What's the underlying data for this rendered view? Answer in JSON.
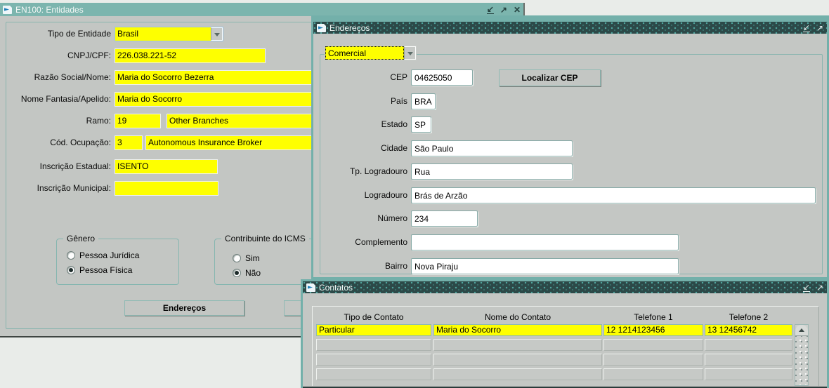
{
  "icons": {
    "minimize": "↙",
    "maximize": "↗",
    "close": "✕"
  },
  "colors": {
    "titlebar_teal": "#7cb5ae",
    "titlebar_dark": "#2c4948",
    "field_yellow": "#feff00",
    "frame_teal": "#73b0aa",
    "window_gray": "#c3c6c3",
    "desktop": "#e9ece9"
  },
  "window_entidades": {
    "title": "EN100: Entidades",
    "fields": {
      "tipo": {
        "label": "Tipo de Entidade",
        "value": "Brasil"
      },
      "cnpj": {
        "label": "CNPJ/CPF:",
        "value": "226.038.221-52"
      },
      "razao": {
        "label": "Razão Social/Nome:",
        "value": "Maria do Socorro Bezerra"
      },
      "fantasia": {
        "label": "Nome Fantasia/Apelido:",
        "value": "Maria do Socorro"
      },
      "ramo": {
        "label": "Ramo:",
        "code": "19",
        "desc": "Other Branches"
      },
      "ocupacao": {
        "label": "Cód. Ocupação:",
        "code": "3",
        "desc": "Autonomous Insurance Broker"
      },
      "insc_estadual": {
        "label": "Inscrição Estadual:",
        "value": "ISENTO"
      },
      "insc_municipal": {
        "label": "Inscrição Municipal:",
        "value": ""
      }
    },
    "genero": {
      "label": "Gênero",
      "options": [
        {
          "text": "Pessoa Jurídica",
          "selected": false
        },
        {
          "text": "Pessoa Física",
          "selected": true
        }
      ]
    },
    "icms": {
      "label": "Contribuinte do ICMS",
      "options": [
        {
          "text": "Sim",
          "selected": false
        },
        {
          "text": "Não",
          "selected": true
        }
      ]
    },
    "buttons": {
      "enderecos": "Endereços"
    }
  },
  "window_enderecos": {
    "title": "Endereços",
    "tipo_endereco": "Comercial",
    "buttons": {
      "localizar_cep": "Localizar CEP"
    },
    "fields": {
      "cep": {
        "label": "CEP",
        "value": "04625050"
      },
      "pais": {
        "label": "País",
        "value": "BRA"
      },
      "estado": {
        "label": "Estado",
        "value": "SP"
      },
      "cidade": {
        "label": "Cidade",
        "value": "São Paulo"
      },
      "tp_logradouro": {
        "label": "Tp. Logradouro",
        "value": "Rua"
      },
      "logradouro": {
        "label": "Logradouro",
        "value": "Brás de Arzão"
      },
      "numero": {
        "label": "Número",
        "value": "234"
      },
      "complemento": {
        "label": "Complemento",
        "value": ""
      },
      "bairro": {
        "label": "Bairro",
        "value": "Nova Piraju"
      }
    }
  },
  "window_contatos": {
    "title": "Contatos",
    "columns": [
      "Tipo de Contato",
      "Nome do Contato",
      "Telefone 1",
      "Telefone 2"
    ],
    "rows": [
      [
        "Particular",
        "Maria do Socorro",
        "12 1214123456",
        "13 12456742"
      ],
      [
        "",
        "",
        "",
        ""
      ],
      [
        "",
        "",
        "",
        ""
      ],
      [
        "",
        "",
        "",
        ""
      ]
    ]
  }
}
